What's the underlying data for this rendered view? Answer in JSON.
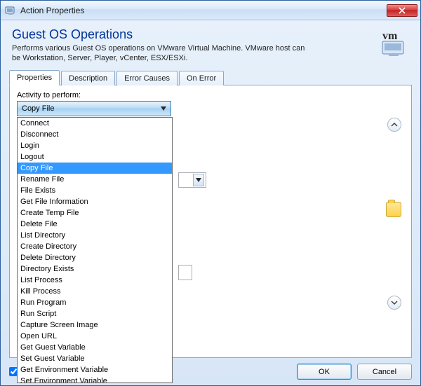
{
  "window": {
    "title": "Action Properties"
  },
  "header": {
    "title": "Guest OS Operations",
    "description": "Performs various Guest OS operations on VMware Virtual Machine. VMware host can be Workstation, Server, Player, vCenter, ESX/ESXi.",
    "logo_text": "vm"
  },
  "tabs": [
    {
      "label": "Properties",
      "active": true
    },
    {
      "label": "Description",
      "active": false
    },
    {
      "label": "Error Causes",
      "active": false
    },
    {
      "label": "On Error",
      "active": false
    }
  ],
  "activity": {
    "label": "Activity to perform:",
    "selected": "Copy File",
    "options": [
      "Connect",
      "Disconnect",
      "Login",
      "Logout",
      "Copy File",
      "Rename File",
      "File Exists",
      "Get File Information",
      "Create Temp File",
      "Delete File",
      "List Directory",
      "Create Directory",
      "Delete Directory",
      "Directory Exists",
      "List Process",
      "Kill Process",
      "Run Program",
      "Run Script",
      "Capture Screen Image",
      "Open URL",
      "Get Guest Variable",
      "Set Guest Variable",
      "Get Environment Variable",
      "Set Environment Variable"
    ]
  },
  "buttons": {
    "ok": "OK",
    "cancel": "Cancel"
  },
  "bottom_checkbox": {
    "checked": true
  }
}
